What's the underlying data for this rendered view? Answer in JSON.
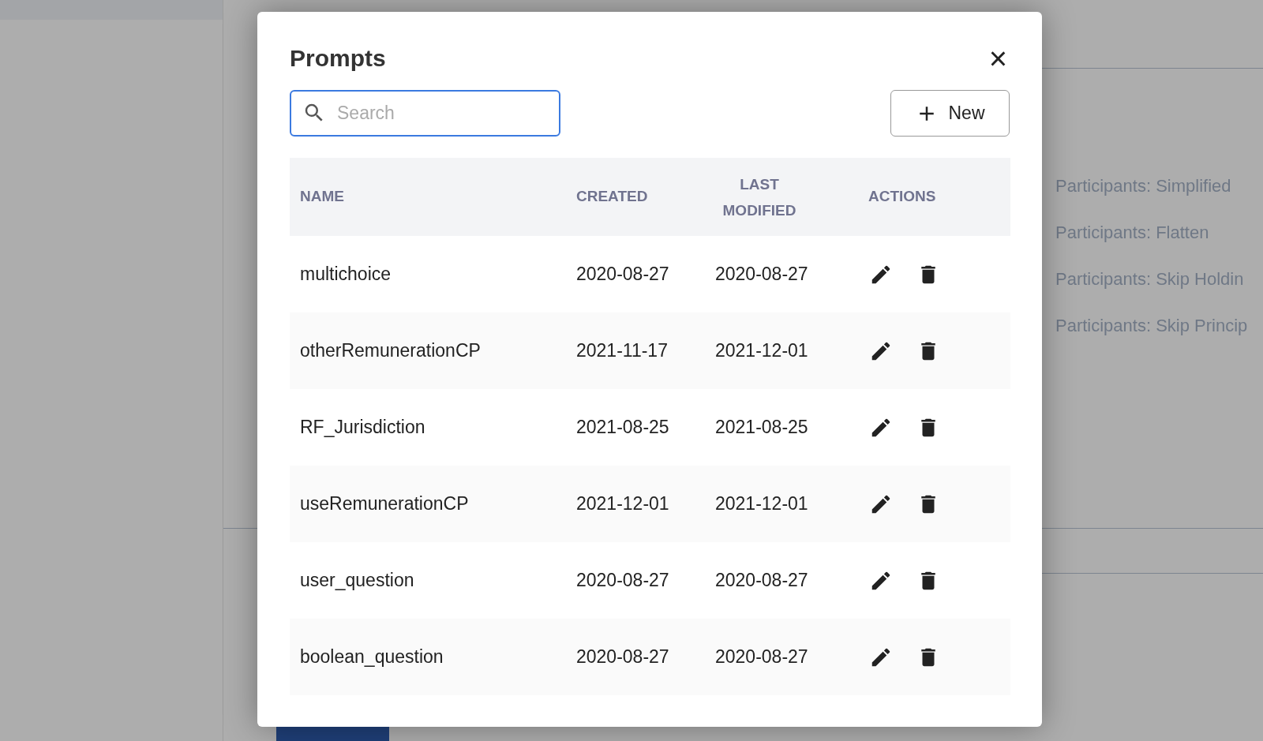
{
  "background": {
    "items": [
      "Participants: Simplified",
      "Participants: Flatten",
      "Participants: Skip Holdin",
      "Participants: Skip Princip"
    ]
  },
  "dialog": {
    "title": "Prompts",
    "close": "×",
    "search": {
      "placeholder": "Search"
    },
    "new_button": "New",
    "table": {
      "columns": [
        "NAME",
        "CREATED",
        "LAST MODIFIED",
        "ACTIONS"
      ],
      "rows": [
        {
          "name": "multichoice",
          "created": "2020-08-27",
          "modified": "2020-08-27"
        },
        {
          "name": "otherRemunerationCP",
          "created": "2021-11-17",
          "modified": "2021-12-01"
        },
        {
          "name": "RF_Jurisdiction",
          "created": "2021-08-25",
          "modified": "2021-08-25"
        },
        {
          "name": "useRemunerationCP",
          "created": "2021-12-01",
          "modified": "2021-12-01"
        },
        {
          "name": "user_question",
          "created": "2020-08-27",
          "modified": "2020-08-27"
        },
        {
          "name": "boolean_question",
          "created": "2020-08-27",
          "modified": "2020-08-27"
        }
      ]
    }
  }
}
